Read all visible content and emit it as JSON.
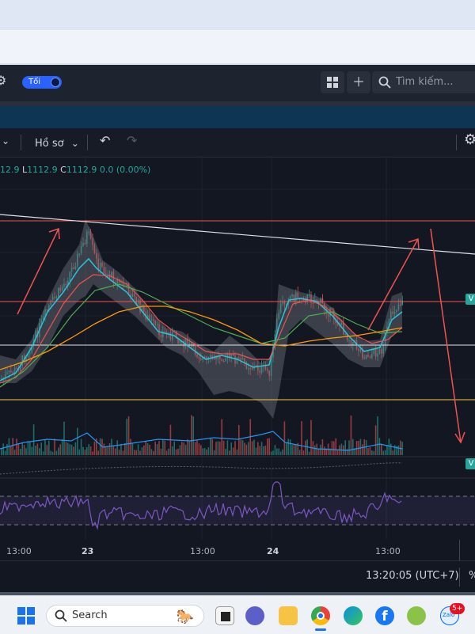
{
  "header": {
    "toggle_label": "Tối",
    "search_placeholder": "Tìm kiếm..."
  },
  "toolbar": {
    "profile_label": "Hồ sơ"
  },
  "legend": {
    "high_partial": "12.9",
    "low_label": "L",
    "low_value": "1112.9",
    "close_label": "C",
    "close_value": "1112.9",
    "change": "0.0 (0.00%)"
  },
  "price_tags": {
    "upper": "V",
    "lower": "V"
  },
  "time_axis": {
    "labels": [
      "13:00",
      "23",
      "13:00",
      "24",
      "13:00"
    ]
  },
  "status": {
    "clock": "13:20:05 (UTC+7)",
    "percent": "%"
  },
  "taskbar": {
    "search_label": "Search",
    "zalo_badge": "5+",
    "zalo_label": "Zalo"
  },
  "colors": {
    "up": "#26a69a",
    "down": "#ef5350",
    "accent": "#2962ff",
    "rsi": "#7e57c2"
  }
}
